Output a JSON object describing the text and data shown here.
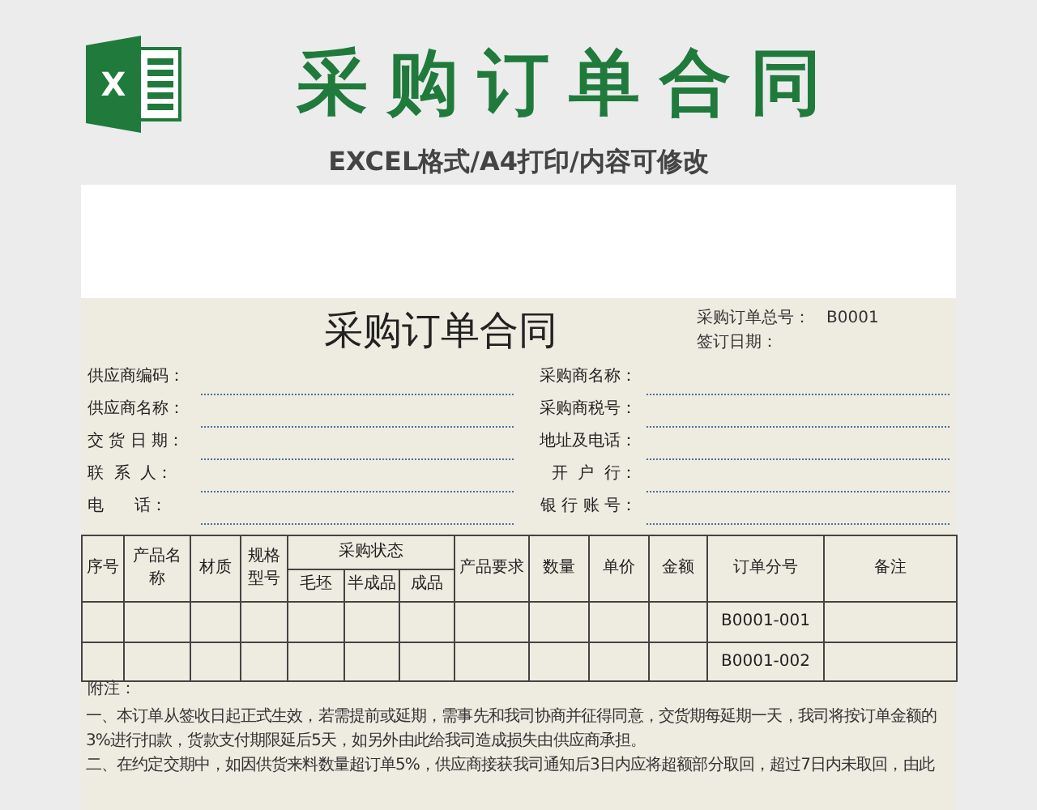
{
  "banner": {
    "logo_letter": "X",
    "title": "采购订单合同",
    "subtitle": "EXCEL格式/A4打印/内容可修改"
  },
  "document": {
    "title": "采购订单合同",
    "meta": [
      {
        "label": "采购订单总号：",
        "value": "B0001"
      },
      {
        "label": "签订日期："
      }
    ],
    "fields_left": [
      "供应商编码：",
      "供应商名称：",
      "交 货 日 期：",
      "联  系  人：",
      "电      话："
    ],
    "fields_right": [
      "采购商名称：",
      "采购商税号：",
      "地址及电话：",
      "开  户  行：",
      "银 行 账 号："
    ],
    "table": {
      "columns": [
        {
          "label": "序号"
        },
        {
          "label": "产品名称"
        },
        {
          "label": "材质"
        },
        {
          "label": "规格型号"
        },
        {
          "label": "采购状态",
          "children": [
            "毛坯",
            "半成品",
            "成品"
          ]
        },
        {
          "label": "产品要求"
        },
        {
          "label": "数量"
        },
        {
          "label": "单价"
        },
        {
          "label": "金额"
        },
        {
          "label": "订单分号"
        },
        {
          "label": "备注"
        }
      ],
      "rows": [
        {
          "order_no": "B0001-001"
        },
        {
          "order_no": "B0001-002"
        }
      ]
    },
    "notes_title": "附注：",
    "notes": [
      "一、本订单从签收日起正式生效，若需提前或延期，需事先和我司协商并征得同意，交货期每延期一天，我司将按订单金额的3%进行扣款，货款支付期限延后5天，如另外由此给我司造成损失由供应商承担。",
      "二、在约定交期中，如因供货来料数量超订单5%，供应商接获我司通知后3日内应将超额部分取回，超过7日内未取回，由此"
    ]
  }
}
